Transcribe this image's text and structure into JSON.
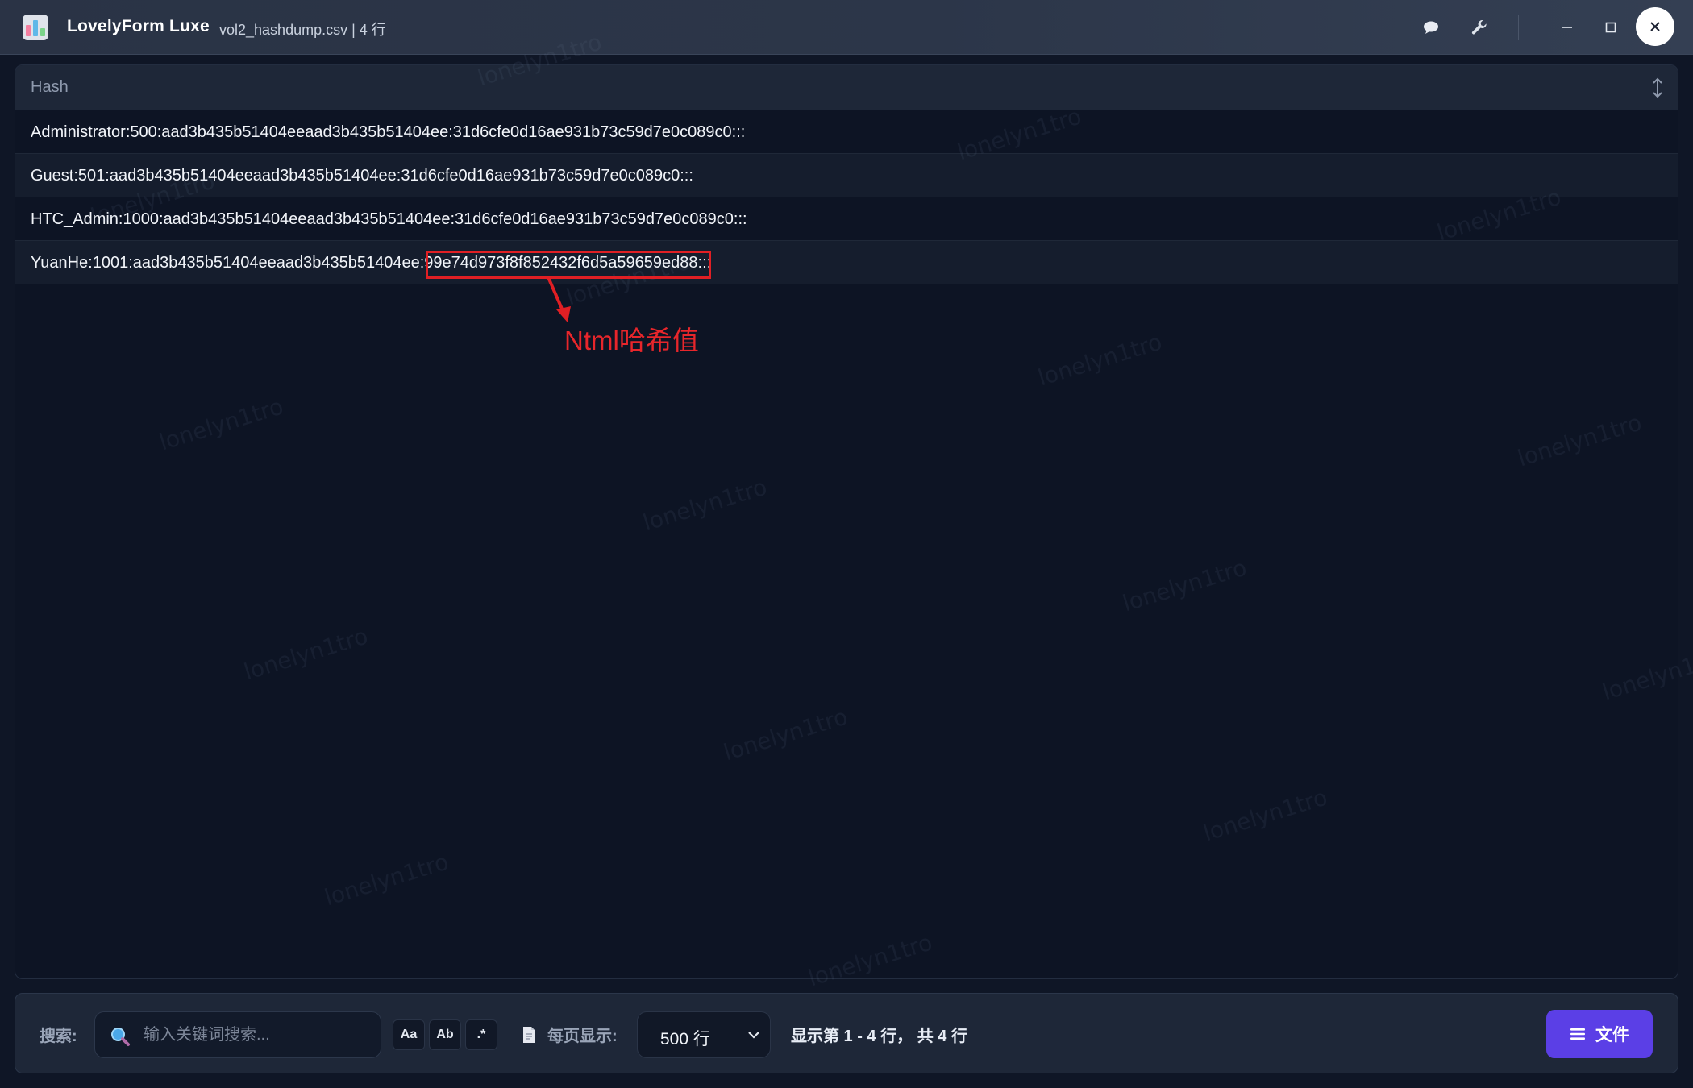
{
  "titlebar": {
    "app_name": "LovelyForm Luxe",
    "file_info": "vol2_hashdump.csv | 4 行",
    "icons": [
      "chat-bubble-icon",
      "wrench-icon",
      "minimize-icon",
      "maximize-icon",
      "close-icon"
    ]
  },
  "table": {
    "column": "Hash",
    "rows": [
      "Administrator:500:aad3b435b51404eeaad3b435b51404ee:31d6cfe0d16ae931b73c59d7e0c089c0:::",
      "Guest:501:aad3b435b51404eeaad3b435b51404ee:31d6cfe0d16ae931b73c59d7e0c089c0:::",
      "HTC_Admin:1000:aad3b435b51404eeaad3b435b51404ee:31d6cfe0d16ae931b73c59d7e0c089c0:::",
      "YuanHe:1001:aad3b435b51404eeaad3b435b51404ee:99e74d973f8f852432f6d5a59659ed88:::"
    ]
  },
  "annotation": {
    "label": "Ntml哈希值",
    "color": "#e01f24"
  },
  "watermark": "lonelyn1tro",
  "bottombar": {
    "search_label": "搜索:",
    "search_placeholder": "输入关键词搜索...",
    "case_option": "Aa",
    "word_option": "Ab",
    "regex_option": ".*",
    "page_size_label": "每页显示:",
    "page_size_value": "500 行",
    "status": "显示第 1 - 4 行， 共 4 行",
    "file_button": "文件"
  },
  "colors": {
    "accent": "#5b3fe6",
    "background": "#0d1424",
    "annotation": "#e01f24"
  }
}
